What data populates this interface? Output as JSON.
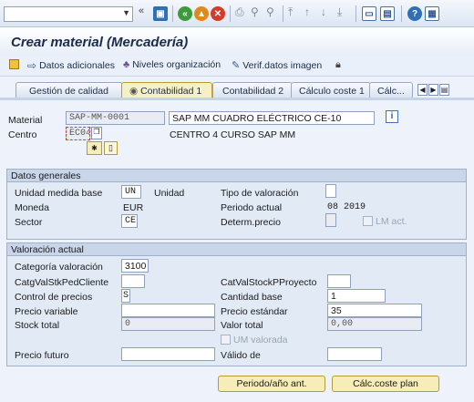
{
  "window": {
    "title": "Crear material (Mercadería)"
  },
  "command_field": {
    "value": ""
  },
  "toolbar_icons": [
    "save-icon",
    "back-icon",
    "exit-icon",
    "cancel-icon",
    "print-icon",
    "find-icon",
    "find-next-icon",
    "first-page-icon",
    "prev-page-icon",
    "next-page-icon",
    "last-page-icon",
    "new-session-icon",
    "shortcut-icon",
    "help-icon",
    "customize-icon"
  ],
  "app_toolbar": {
    "datos_adicionales": "Datos adicionales",
    "niveles_organizacion": "Niveles organización",
    "verif_datos_imagen": "Verif.datos imagen"
  },
  "tabs": [
    {
      "label": "Gestión de calidad",
      "active": false
    },
    {
      "label": "Contabilidad 1",
      "active": true
    },
    {
      "label": "Contabilidad 2",
      "active": false
    },
    {
      "label": "Cálculo coste 1",
      "active": false
    },
    {
      "label": "Cálc...",
      "active": false
    }
  ],
  "header": {
    "material_label": "Material",
    "material_value": "SAP-MM-0001",
    "material_desc": "SAP MM CUADRO ELÉCTRICO CE-10",
    "centro_label": "Centro",
    "centro_value": "EC04",
    "centro_desc": "CENTRO 4 CURSO SAP MM"
  },
  "datos_generales": {
    "title": "Datos generales",
    "unidad_medida_label": "Unidad medida base",
    "unidad_medida_value": "UN",
    "unidad_medida_text": "Unidad",
    "tipo_valoracion_label": "Tipo de valoración",
    "tipo_valoracion_value": "",
    "moneda_label": "Moneda",
    "moneda_value": "EUR",
    "periodo_actual_label": "Periodo actual",
    "periodo_actual_value": "08 2019",
    "sector_label": "Sector",
    "sector_value": "CE",
    "determ_precio_label": "Determ.precio",
    "determ_precio_value": "",
    "lm_act_label": "LM act."
  },
  "valoracion_actual": {
    "title": "Valoración actual",
    "categoria_label": "Categoría valoración",
    "categoria_value": "3100",
    "catg_val_stk_label": "CatgValStkPedCliente",
    "catg_val_stk_value": "",
    "cat_val_stock_proy_label": "CatValStockPProyecto",
    "cat_val_stock_proy_value": "",
    "control_precios_label": "Control de precios",
    "control_precios_value": "S",
    "cantidad_base_label": "Cantidad base",
    "cantidad_base_value": "1",
    "precio_variable_label": "Precio variable",
    "precio_variable_value": "",
    "precio_estandar_label": "Precio estándar",
    "precio_estandar_value": "35",
    "stock_total_label": "Stock total",
    "stock_total_value": "0",
    "valor_total_label": "Valor total",
    "valor_total_value": "0,00",
    "um_valorada_label": "UM valorada",
    "precio_futuro_label": "Precio futuro",
    "precio_futuro_value": "",
    "valido_de_label": "Válido de",
    "valido_de_value": ""
  },
  "buttons": {
    "periodo_ano_ant": "Periodo/año ant.",
    "calc_coste_plan": "Cálc.coste plan"
  }
}
